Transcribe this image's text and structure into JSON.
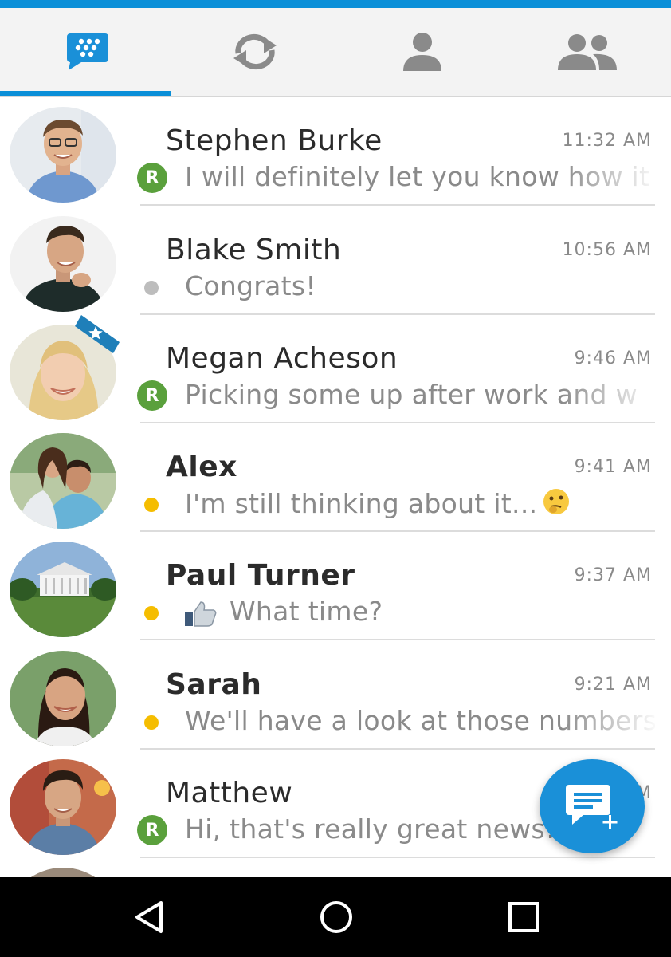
{
  "tabs": {
    "chats": "chat-bubble-icon",
    "updates": "refresh-icon",
    "contacts": "person-icon",
    "groups": "group-icon",
    "accent_color": "#0a8fd8"
  },
  "chats": [
    {
      "name": "Stephen Burke",
      "time": "11:32 AM",
      "preview": "I will definitely let you know how it",
      "status": "R",
      "bold": false
    },
    {
      "name": "Blake Smith",
      "time": "10:56 AM",
      "preview": "Congrats!",
      "status": "grey-dot",
      "bold": false
    },
    {
      "name": "Megan Acheson",
      "time": "9:46 AM",
      "preview": "Picking some up after work and w",
      "status": "R",
      "bold": false
    },
    {
      "name": "Alex",
      "time": "9:41 AM",
      "preview": "I'm still thinking about it...",
      "status": "yellow-dot",
      "bold": true
    },
    {
      "name": "Paul Turner",
      "time": "9:37 AM",
      "preview": "What time?",
      "status": "yellow-dot",
      "bold": true
    },
    {
      "name": "Sarah",
      "time": "9:21 AM",
      "preview": "We'll have a look at those numbers",
      "status": "yellow-dot",
      "bold": true
    },
    {
      "name": "Matthew",
      "time": "9:07 AM",
      "preview": "Hi, that's really great news!",
      "status": "R",
      "bold": false
    }
  ],
  "fab": {
    "icon": "new-chat-icon",
    "color": "#1a90d8"
  },
  "status_badge_letter": "R",
  "navbar": {
    "back": "back-triangle-icon",
    "home": "home-circle-icon",
    "recents": "recents-square-icon"
  }
}
